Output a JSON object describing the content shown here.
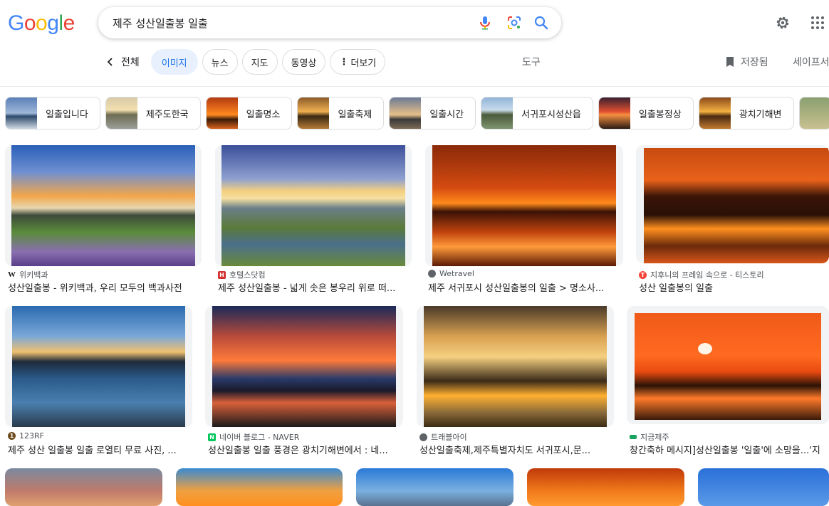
{
  "header": {
    "query": "제주 성산일출봉 일출",
    "logo": [
      "G",
      "o",
      "o",
      "g",
      "l",
      "e"
    ],
    "logo_colors": [
      "#4285f4",
      "#ea4335",
      "#fbbc05",
      "#4285f4",
      "#34a853",
      "#ea4335"
    ]
  },
  "tabs": {
    "all": "전체",
    "images": "이미지",
    "news": "뉴스",
    "maps": "지도",
    "videos": "동영상",
    "more": "더보기",
    "tools": "도구",
    "saved": "저장됨",
    "safesearch": "세이프서"
  },
  "related": [
    {
      "label": "일출입니다"
    },
    {
      "label": "제주도한국"
    },
    {
      "label": "일출명소"
    },
    {
      "label": "일출축제"
    },
    {
      "label": "일출시간"
    },
    {
      "label": "서귀포시성산읍"
    },
    {
      "label": "일출봉정상"
    },
    {
      "label": "광치기해변"
    }
  ],
  "results": [
    {
      "source": "위키백과",
      "title": "성산일출봉 - 위키백과, 우리 모두의 백과사전",
      "fav": "W",
      "fav_color": "#202124"
    },
    {
      "source": "호텔스닷컴",
      "title": "제주 성산일출봉 - 넓게 솟은 봉우리 위로 떠...",
      "fav": "H",
      "fav_color": "#d32f2f"
    },
    {
      "source": "Wetravel",
      "title": "제주 서귀포시 성산일출봉의 일출 > 명소사...",
      "fav": "",
      "fav_color": "#5f6368"
    },
    {
      "source": "지후니의 프레임 속으로 - 티스토리",
      "title": "성산 일출봉의 일출",
      "fav": "T",
      "fav_color": "#f44336"
    },
    {
      "source": "123RF",
      "title": "제주 성산 일출봉 일출 로열티 무료 사진, ...",
      "fav": "1",
      "fav_color": "#6d4c1f"
    },
    {
      "source": "네이버 블로그 - NAVER",
      "title": "성산일출봉 일출 풍경은 광치기해변에서 : 네...",
      "fav": "N",
      "fav_color": "#03c75a"
    },
    {
      "source": "트래블아이",
      "title": "성산일출축제,제주특별자치도 서귀포시,문...",
      "fav": "",
      "fav_color": "#5f6368"
    },
    {
      "source": "지금제주",
      "title": "창간축하 메시지]성산일출봉 '일출'에 소망을...'지",
      "fav": "",
      "fav_color": "#1aa260"
    }
  ]
}
